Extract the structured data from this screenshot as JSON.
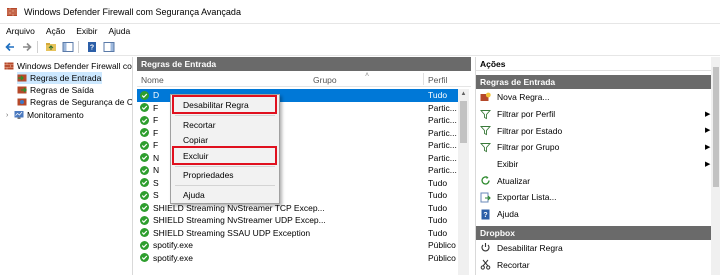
{
  "window": {
    "title": "Windows Defender Firewall com Segurança Avançada"
  },
  "menu": [
    "Arquivo",
    "Ação",
    "Exibir",
    "Ajuda"
  ],
  "tree": [
    {
      "label": "Windows Defender Firewall com"
    },
    {
      "label": "Regras de Entrada"
    },
    {
      "label": "Regras de Saída"
    },
    {
      "label": "Regras de Segurança de Co"
    },
    {
      "label": "Monitoramento"
    }
  ],
  "center": {
    "header": "Regras de Entrada",
    "columns": {
      "name": "Nome",
      "group": "Grupo",
      "profile": "Perfil"
    },
    "rows": [
      {
        "name": "D",
        "profile": "Tudo"
      },
      {
        "name": "F",
        "profile": "Partic..."
      },
      {
        "name": "F",
        "profile": "Partic..."
      },
      {
        "name": "F                                          efox)",
        "profile": "Partic..."
      },
      {
        "name": "F                                          efox)",
        "profile": "Partic..."
      },
      {
        "name": "N                                          ption",
        "profile": "Partic..."
      },
      {
        "name": "N                                          ption",
        "profile": "Partic..."
      },
      {
        "name": "S                                          ption",
        "profile": "Tudo"
      },
      {
        "name": "S                                          ption",
        "profile": "Tudo"
      },
      {
        "name": "SHIELD Streaming NvStreamer TCP Excep...",
        "profile": "Tudo"
      },
      {
        "name": "SHIELD Streaming NvStreamer UDP Excep...",
        "profile": "Tudo"
      },
      {
        "name": "SHIELD Streaming SSAU UDP Exception",
        "profile": "Tudo"
      },
      {
        "name": "spotify.exe",
        "profile": "Público"
      },
      {
        "name": "spotify.exe",
        "profile": "Público"
      }
    ]
  },
  "context_menu": {
    "items": [
      "Desabilitar Regra",
      "Recortar",
      "Copiar",
      "Excluir",
      "Propriedades",
      "Ajuda"
    ]
  },
  "actions": {
    "title": "Ações",
    "group1": "Regras de Entrada",
    "items1": [
      {
        "label": "Nova Regra...",
        "icon": "new-rule-icon"
      },
      {
        "label": "Filtrar por Perfil",
        "icon": "filter-icon",
        "submenu": true
      },
      {
        "label": "Filtrar por Estado",
        "icon": "filter-icon",
        "submenu": true
      },
      {
        "label": "Filtrar por Grupo",
        "icon": "filter-icon",
        "submenu": true
      },
      {
        "label": "Exibir",
        "icon": "",
        "submenu": true
      },
      {
        "label": "Atualizar",
        "icon": "refresh-icon"
      },
      {
        "label": "Exportar Lista...",
        "icon": "export-icon"
      },
      {
        "label": "Ajuda",
        "icon": "help-icon"
      }
    ],
    "group2": "Dropbox",
    "items2": [
      {
        "label": "Desabilitar Regra",
        "icon": "disable-icon"
      },
      {
        "label": "Recortar",
        "icon": "cut-icon"
      }
    ]
  },
  "colors": {
    "accent": "#0078d7",
    "header_gray": "#6a6a6a",
    "highlight_red": "#e0101e",
    "check_green": "#2e9e2e"
  }
}
